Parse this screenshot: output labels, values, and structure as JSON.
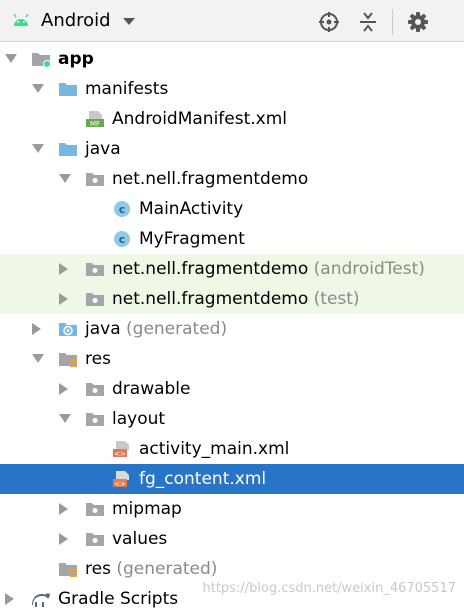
{
  "toolbar": {
    "title": "Android",
    "icons": [
      "android-logo",
      "chevron-down-icon",
      "locate-icon",
      "collapse-all-icon",
      "gear-icon"
    ]
  },
  "tree": {
    "rows": [
      {
        "label": "app",
        "suffix": ""
      },
      {
        "label": "manifests",
        "suffix": ""
      },
      {
        "label": "AndroidManifest.xml",
        "suffix": ""
      },
      {
        "label": "java",
        "suffix": ""
      },
      {
        "label": "net.nell.fragmentdemo",
        "suffix": ""
      },
      {
        "label": "MainActivity",
        "suffix": ""
      },
      {
        "label": "MyFragment",
        "suffix": ""
      },
      {
        "label": "net.nell.fragmentdemo",
        "suffix": " (androidTest)"
      },
      {
        "label": "net.nell.fragmentdemo",
        "suffix": " (test)"
      },
      {
        "label": "java",
        "suffix": " (generated)"
      },
      {
        "label": "res",
        "suffix": ""
      },
      {
        "label": "drawable",
        "suffix": ""
      },
      {
        "label": "layout",
        "suffix": ""
      },
      {
        "label": "activity_main.xml",
        "suffix": ""
      },
      {
        "label": "fg_content.xml",
        "suffix": ""
      },
      {
        "label": "mipmap",
        "suffix": ""
      },
      {
        "label": "values",
        "suffix": ""
      },
      {
        "label": "res",
        "suffix": " (generated)"
      },
      {
        "label": "Gradle Scripts",
        "suffix": ""
      }
    ],
    "selected_label": "fg_content.xml"
  },
  "watermark": "https://blog.csdn.net/weixin_46705517",
  "colors": {
    "selection": "#2874c7",
    "library_row": "#eff7e6",
    "folder_blue": "#79b7e3",
    "package_gray": "#a2a6ab",
    "class_badge": "#8fc9e8"
  }
}
